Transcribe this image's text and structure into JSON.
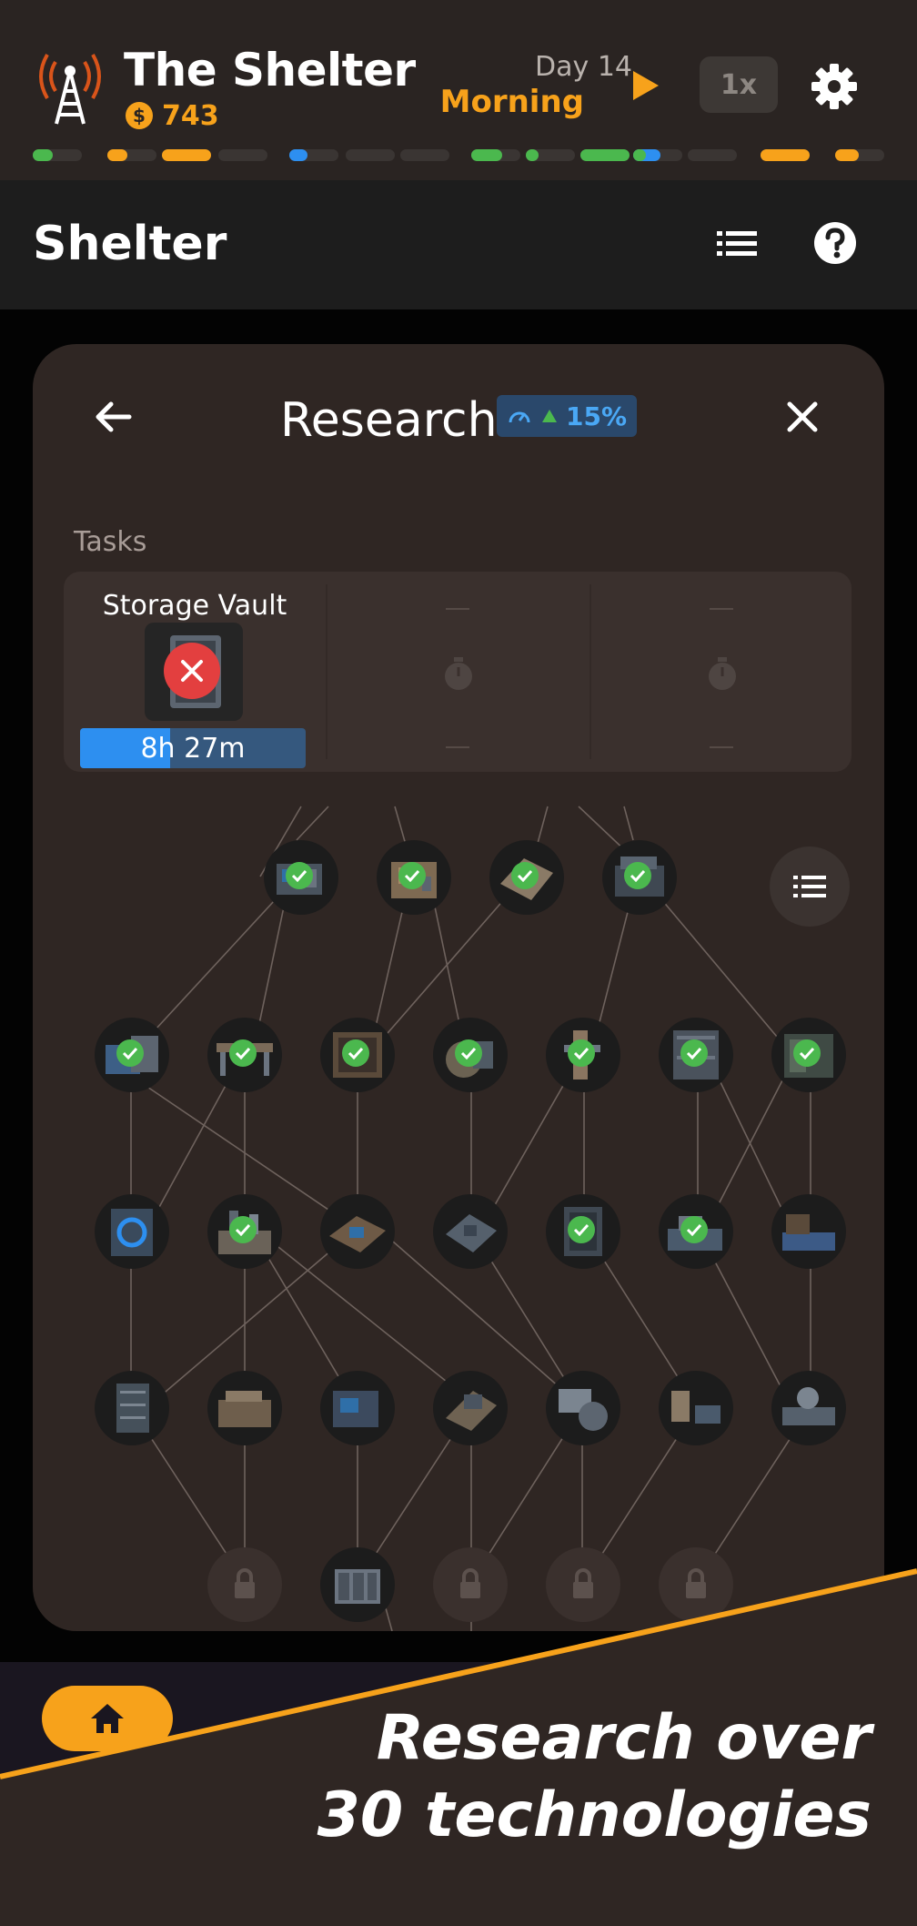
{
  "status": {
    "app_title": "The Shelter",
    "money": "743",
    "money_icon": "$",
    "day": "Day 14",
    "time_of_day": "Morning",
    "speed": "1x"
  },
  "header": {
    "title": "Shelter"
  },
  "research": {
    "title": "Research",
    "bonus": "15%",
    "tasks_label": "Tasks",
    "active_task": {
      "name": "Storage Vault",
      "remaining": "8h 27m",
      "progress": 0.4
    }
  },
  "promo": {
    "line1": "Research over",
    "line2": "30 technologies"
  },
  "colors": {
    "accent": "#f7a21b",
    "blue": "#2d8ff0",
    "green": "#4bb84e",
    "red": "#e33f3f"
  }
}
